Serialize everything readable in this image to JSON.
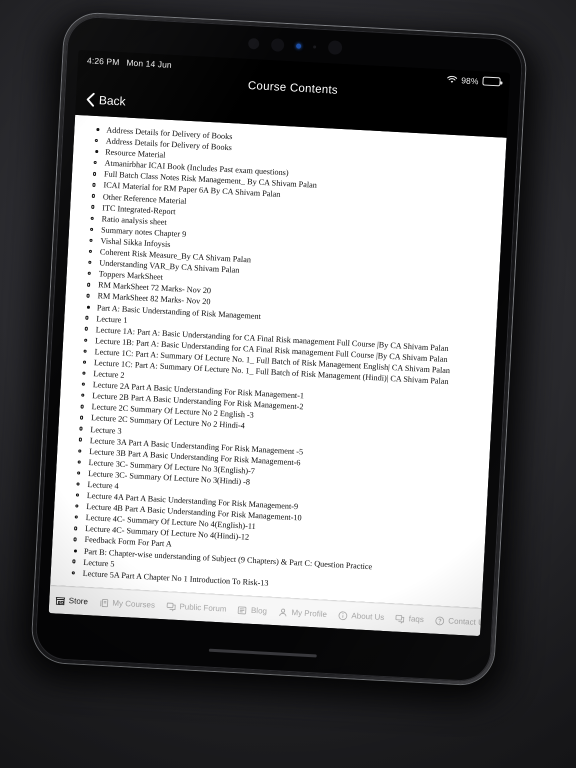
{
  "device": {
    "status_bar": {
      "time": "4:26 PM",
      "date": "Mon 14 Jun",
      "wifi_icon": "wifi-icon",
      "battery_percent": "98%",
      "battery_icon": "battery-icon"
    }
  },
  "nav": {
    "back_label": "Back",
    "back_icon": "chevron-left-icon",
    "title": "Course Contents"
  },
  "colors": {
    "nav_background": "#000000",
    "content_background": "#ffffff",
    "tab_active": "#1a1a1a",
    "tab_inactive": "#a9a9a9",
    "sensor_led": "#1d4fa8"
  },
  "toc": [
    {
      "label": "Address Details for Delivery of Books",
      "children": [
        "Address Details for Delivery of Books"
      ]
    },
    {
      "label": "Resource Material",
      "children": [
        "Atmanirbhar ICAI Book (Includes Past exam questions)",
        "Full Batch Class Notes Risk Management_ By CA Shivam Palan",
        "ICAI Material for RM Paper 6A By CA Shivam Palan",
        "Other Reference Material",
        "ITC Integrated-Report",
        "Ratio analysis sheet",
        "Summary notes Chapter 9",
        "Vishal Sikka Infoysis",
        "Coherent Risk Measure_By CA Shivam Palan",
        "Understanding VAR_By CA Shivam Palan",
        "Toppers MarkSheet",
        "RM MarkSheet 72 Marks- Nov 20",
        "RM MarkSheet 82 Marks- Nov 20"
      ]
    },
    {
      "label": "Part A: Basic Understanding of Risk Management",
      "children": [
        "Lecture 1",
        "Lecture 1A: Part A: Basic Understanding for CA Final Risk management Full Course |By CA Shivam Palan",
        "Lecture 1B: Part A: Basic Understanding for CA Final Risk management Full Course |By CA Shivam Palan",
        "Lecture 1C: Part A: Summary Of Lecture No. 1_ Full Batch of Risk Management English| CA Shivam Palan",
        "Lecture 1C: Part A: Summary Of Lecture No. 1_ Full Batch of Risk Management (Hindi)| CA Shivam Palan",
        "Lecture 2",
        "Lecture 2A Part A Basic Understanding For Risk Management-1",
        "Lecture 2B Part A Basic Understanding For Risk Management-2",
        "Lecture 2C Summary Of Lecture No 2 English -3",
        "Lecture 2C Summary Of Lecture No 2 Hindi-4",
        "Lecture 3",
        "Lecture 3A Part A Basic Understanding For Risk Management -5",
        "Lecture 3B Part A Basic Understanding For Risk Management-6",
        "Lecture 3C- Summary Of Lecture No 3(English)-7",
        "Lecture 3C- Summary Of Lecture No 3(Hindi) -8",
        "Lecture 4",
        "Lecture 4A Part A Basic Understanding For Risk Management-9",
        "Lecture 4B Part A Basic Understanding For Risk Management-10",
        "Lecture 4C- Summary Of Lecture No 4(English)-11",
        "Lecture 4C- Summary Of Lecture No 4(Hindi)-12",
        "Feedback Form For Part A"
      ]
    },
    {
      "label": "Part B: Chapter-wise understanding of Subject (9 Chapters) & Part C: Question Practice",
      "children": [
        "Lecture 5",
        "Lecture 5A Part A Chapter No 1 Introduction To Risk-13"
      ]
    }
  ],
  "tab_bar": [
    {
      "label": "Store",
      "icon": "store-icon",
      "active": true
    },
    {
      "label": "My Courses",
      "icon": "courses-icon",
      "active": false
    },
    {
      "label": "Public Forum",
      "icon": "forum-icon",
      "active": false
    },
    {
      "label": "Blog",
      "icon": "blog-icon",
      "active": false
    },
    {
      "label": "My Profile",
      "icon": "person-icon",
      "active": false
    },
    {
      "label": "About Us",
      "icon": "info-circle-icon",
      "active": false
    },
    {
      "label": "faqs",
      "icon": "faq-icon",
      "active": false
    },
    {
      "label": "Contact Us",
      "icon": "question-circle-icon",
      "active": false
    }
  ]
}
